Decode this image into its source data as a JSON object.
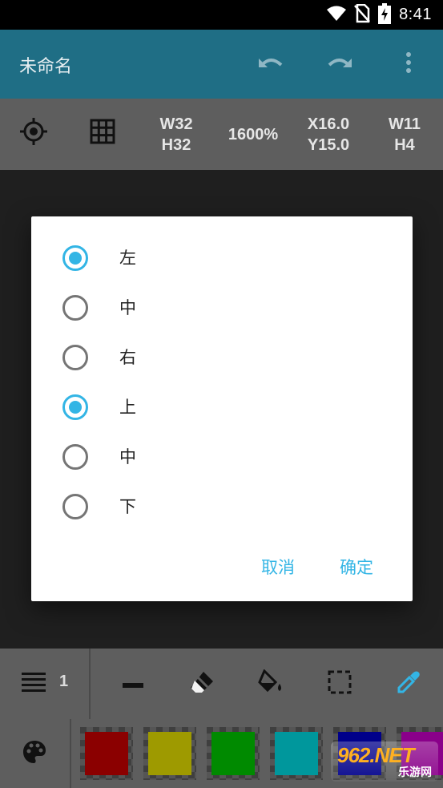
{
  "status_bar": {
    "time": "8:41",
    "icons": [
      "wifi-icon",
      "no-sim-icon",
      "battery-charging-icon"
    ]
  },
  "app_bar": {
    "title": "未命名",
    "actions": [
      "undo-icon",
      "redo-icon",
      "more-vert-icon"
    ]
  },
  "info_bar": {
    "size_w": "W32",
    "size_h": "H32",
    "zoom": "1600%",
    "pos_x": "X16.0",
    "pos_y": "Y15.0",
    "sel_w": "W11",
    "sel_h": "H4"
  },
  "dialog": {
    "options": [
      {
        "label": "左",
        "checked": true
      },
      {
        "label": "中",
        "checked": false
      },
      {
        "label": "右",
        "checked": false
      },
      {
        "label": "上",
        "checked": true
      },
      {
        "label": "中",
        "checked": false
      },
      {
        "label": "下",
        "checked": false
      }
    ],
    "cancel_label": "取消",
    "ok_label": "确定"
  },
  "tool_bar": {
    "line_width": "1",
    "tools": [
      "line-tool-icon",
      "eraser-icon",
      "fill-bucket-icon",
      "selection-icon",
      "eyedropper-icon"
    ]
  },
  "palette": {
    "colors": [
      "#8b0000",
      "#9e9a00",
      "#008a00",
      "#00979c",
      "#00008a",
      "#8a008a"
    ]
  },
  "watermark": {
    "top": "962.NET",
    "bottom": "乐游网"
  },
  "colors": {
    "accent": "#33b5e5",
    "app_bar": "#1f6e85",
    "toolbar": "#5e5e5e"
  }
}
